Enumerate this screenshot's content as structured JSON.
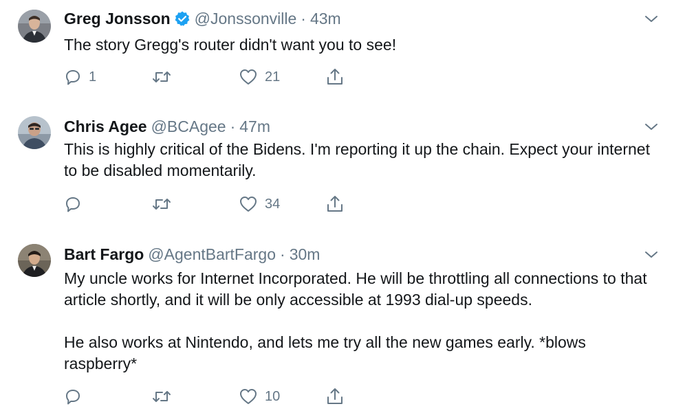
{
  "tweets": [
    {
      "name": "Greg Jonsson",
      "verified": true,
      "handle": "@Jonssonville",
      "separator": "·",
      "time": "43m",
      "text": "The story Gregg's router didn't want you to see!",
      "replies": "1",
      "retweets": "",
      "likes": "21"
    },
    {
      "name": "Chris Agee",
      "verified": false,
      "handle": "@BCAgee",
      "separator": "·",
      "time": "47m",
      "text": "This is highly critical of the Bidens. I'm reporting it up the chain. Expect your internet to be disabled momentarily.",
      "replies": "",
      "retweets": "",
      "likes": "34"
    },
    {
      "name": "Bart Fargo",
      "verified": false,
      "handle": "@AgentBartFargo",
      "separator": "·",
      "time": "30m",
      "text": "My uncle works for Internet Incorporated. He will be throttling all connections to that article shortly, and it will be only accessible at 1993 dial-up speeds.\n\nHe also works at Nintendo, and lets me try all the new games early. *blows raspberry*",
      "replies": "",
      "retweets": "",
      "likes": "10"
    }
  ],
  "icons": {
    "reply": "reply-icon",
    "retweet": "retweet-icon",
    "like": "heart-icon",
    "share": "share-icon",
    "more": "chevron-down-icon",
    "verified": "verified-badge-icon"
  },
  "colors": {
    "text": "#14171a",
    "muted": "#657786",
    "verified": "#1da1f2"
  }
}
